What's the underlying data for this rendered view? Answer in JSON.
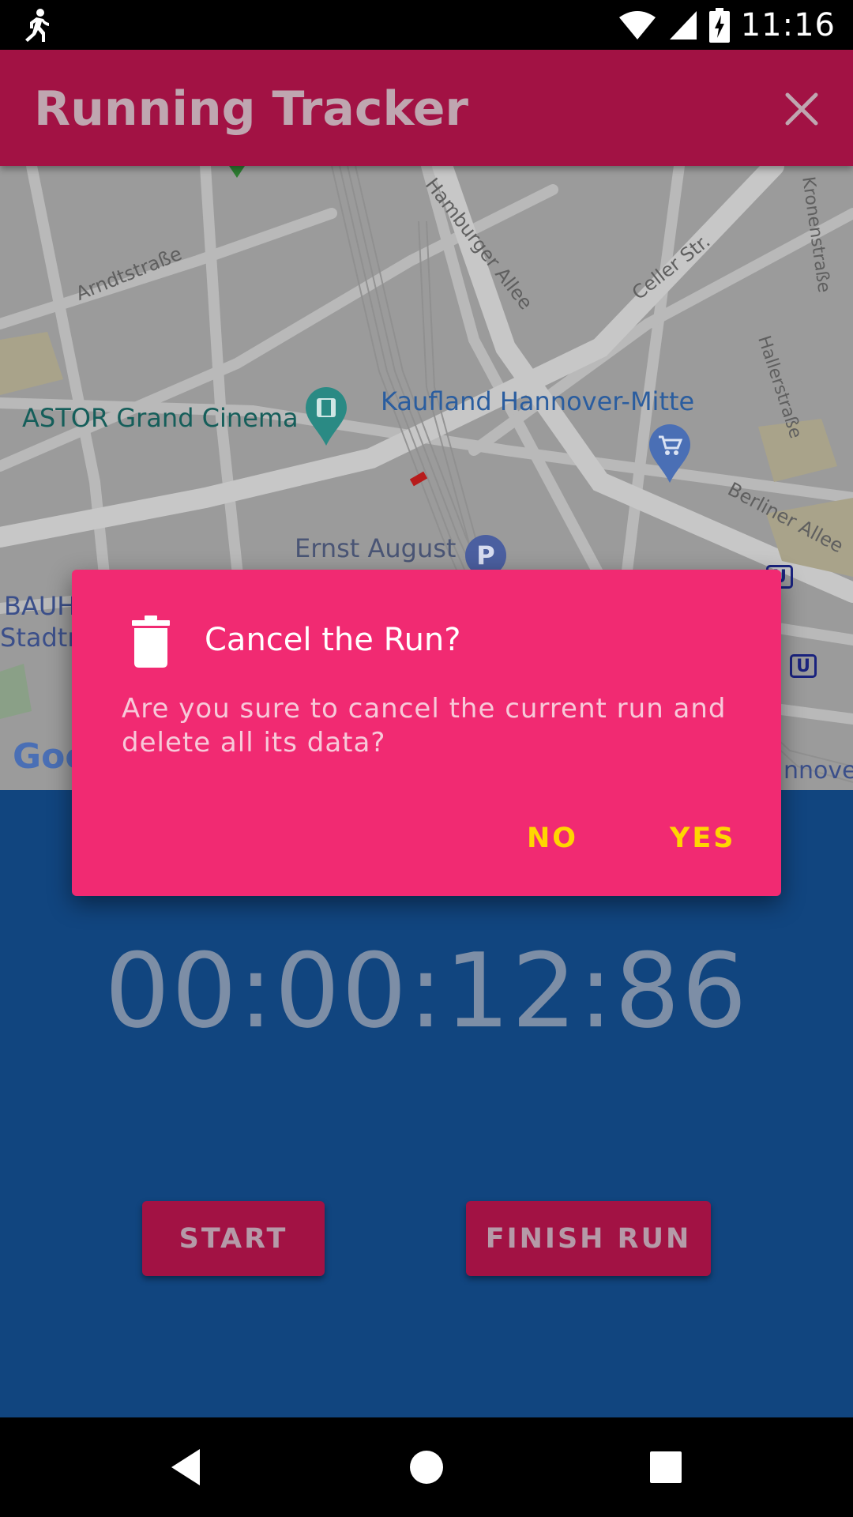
{
  "status_bar": {
    "time": "11:16"
  },
  "app_bar": {
    "title": "Running Tracker"
  },
  "map": {
    "streets": [
      "Arndtstraße",
      "Hamburger Allee",
      "Celler Str.",
      "Kronenstraße",
      "Hallerstraße",
      "Berliner Allee"
    ],
    "places": [
      "ASTOR Grand Cinema",
      "Kaufland Hannover-Mitte",
      "Ernst August"
    ],
    "edge_fragments": [
      "BAUH",
      "Stadtr",
      "nnover"
    ],
    "logo": "Goo",
    "parking_marker": "P",
    "transit_marker": "U"
  },
  "timer": {
    "value": "00:00:12:86"
  },
  "buttons": {
    "start": "START",
    "finish": "FINISH RUN"
  },
  "dialog": {
    "title": "Cancel the Run?",
    "message": "Are you sure to cancel the current run and delete all its data?",
    "no": "NO",
    "yes": "YES"
  },
  "colors": {
    "app_bar": "#a21244",
    "dialog": "#f12a72",
    "dialog_button": "#ffd600",
    "panel": "#11457f"
  }
}
